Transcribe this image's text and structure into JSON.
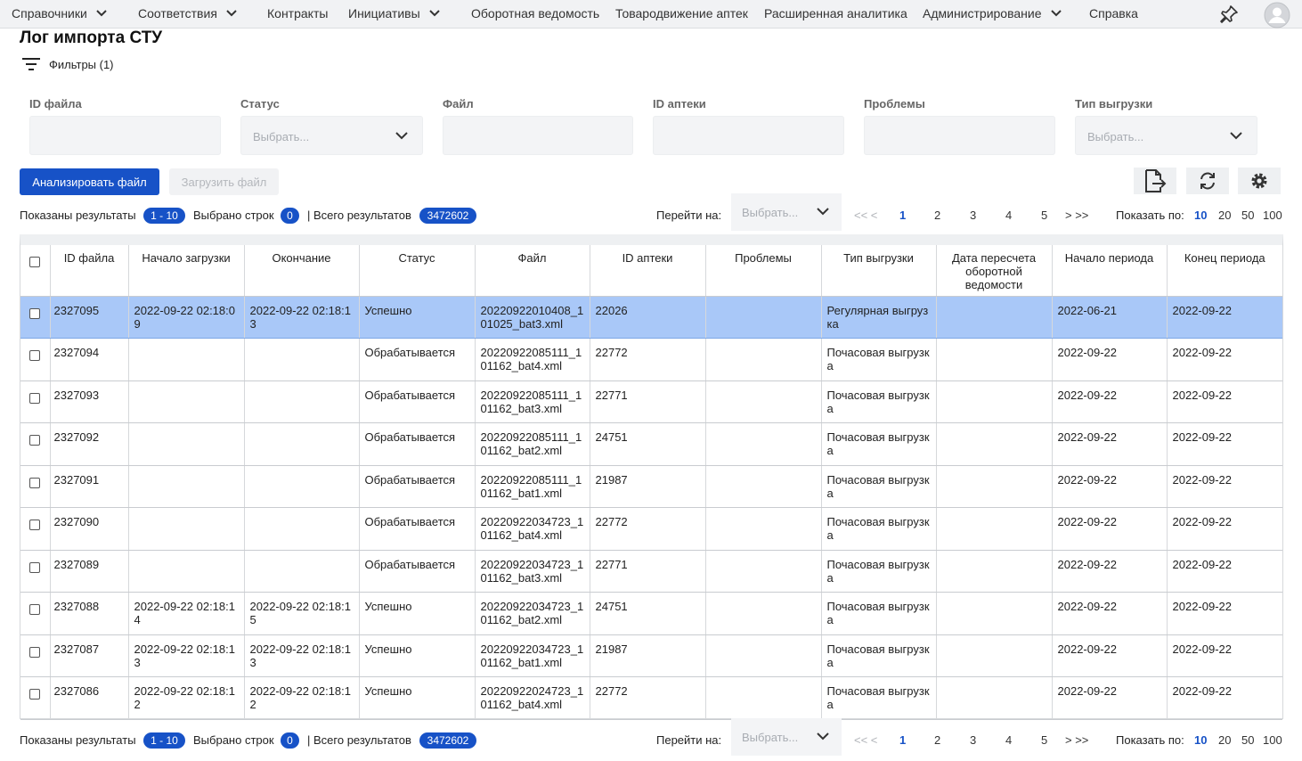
{
  "nav": {
    "items": [
      {
        "label": "Справочники",
        "has_dropdown": true
      },
      {
        "label": "Соответствия",
        "has_dropdown": true
      },
      {
        "label": "Контракты",
        "has_dropdown": false
      },
      {
        "label": "Инициативы",
        "has_dropdown": true
      },
      {
        "label": "Оборотная ведомость",
        "has_dropdown": false
      },
      {
        "label": "Товародвижение аптек",
        "has_dropdown": false
      },
      {
        "label": "Расширенная аналитика",
        "has_dropdown": false
      },
      {
        "label": "Администрирование",
        "has_dropdown": true
      },
      {
        "label": "Справка",
        "has_dropdown": false
      }
    ],
    "icons": [
      "pin-icon",
      "user-avatar-icon"
    ]
  },
  "page": {
    "title": "Лог импорта СТУ",
    "filters_label": "Фильтры (1)"
  },
  "filters": {
    "file_id": {
      "label": "ID файла",
      "value": ""
    },
    "status": {
      "label": "Статус",
      "placeholder": "Выбрать..."
    },
    "file": {
      "label": "Файл",
      "value": ""
    },
    "pharmacy_id": {
      "label": "ID аптеки",
      "value": ""
    },
    "problems": {
      "label": "Проблемы",
      "value": ""
    },
    "export_type": {
      "label": "Тип выгрузки",
      "placeholder": "Выбрать..."
    }
  },
  "toolbar": {
    "analyze_label": "Анализировать файл",
    "upload_label": "Загрузить файл",
    "icons": [
      "export-file-icon",
      "refresh-icon",
      "settings-gear-icon"
    ]
  },
  "pager": {
    "shown_label": "Показаны результаты",
    "shown_range": "1 - 10",
    "selected_label": "Выбрано строк",
    "selected_count": "0",
    "total_label": "| Всего результатов",
    "total_count": "3472602",
    "goto_label": "Перейти на:",
    "goto_placeholder": "Выбрать...",
    "first_prev": "<< <",
    "pages": [
      "1",
      "2",
      "3",
      "4",
      "5"
    ],
    "current_page": "1",
    "next_last": "> >>",
    "page_size_label": "Показать по:",
    "page_sizes": [
      "10",
      "20",
      "50",
      "100"
    ],
    "current_page_size": "10"
  },
  "table": {
    "columns": [
      "ID файла",
      "Начало загрузки",
      "Окончание",
      "Статус",
      "Файл",
      "ID аптеки",
      "Проблемы",
      "Тип выгрузки",
      "Дата пересчета оборотной ведомости",
      "Начало периода",
      "Конец периода"
    ],
    "rows": [
      {
        "id": "2327095",
        "start": "2022-09-22 02:18:09",
        "end": "2022-09-22 02:18:13",
        "status": "Успешно",
        "file": "20220922010408_101025_bat3.xml",
        "pharmacy": "22026",
        "problems": "",
        "type": "Регулярная выгрузка",
        "recalc": "",
        "period_start": "2022-06-21",
        "period_end": "2022-09-22",
        "selected": true
      },
      {
        "id": "2327094",
        "start": "",
        "end": "",
        "status": "Обрабатывается",
        "file": "20220922085111_101162_bat4.xml",
        "pharmacy": "22772",
        "problems": "",
        "type": "Почасовая выгрузка",
        "recalc": "",
        "period_start": "2022-09-22",
        "period_end": "2022-09-22",
        "selected": false
      },
      {
        "id": "2327093",
        "start": "",
        "end": "",
        "status": "Обрабатывается",
        "file": "20220922085111_101162_bat3.xml",
        "pharmacy": "22771",
        "problems": "",
        "type": "Почасовая выгрузка",
        "recalc": "",
        "period_start": "2022-09-22",
        "period_end": "2022-09-22",
        "selected": false
      },
      {
        "id": "2327092",
        "start": "",
        "end": "",
        "status": "Обрабатывается",
        "file": "20220922085111_101162_bat2.xml",
        "pharmacy": "24751",
        "problems": "",
        "type": "Почасовая выгрузка",
        "recalc": "",
        "period_start": "2022-09-22",
        "period_end": "2022-09-22",
        "selected": false
      },
      {
        "id": "2327091",
        "start": "",
        "end": "",
        "status": "Обрабатывается",
        "file": "20220922085111_101162_bat1.xml",
        "pharmacy": "21987",
        "problems": "",
        "type": "Почасовая выгрузка",
        "recalc": "",
        "period_start": "2022-09-22",
        "period_end": "2022-09-22",
        "selected": false
      },
      {
        "id": "2327090",
        "start": "",
        "end": "",
        "status": "Обрабатывается",
        "file": "20220922034723_101162_bat4.xml",
        "pharmacy": "22772",
        "problems": "",
        "type": "Почасовая выгрузка",
        "recalc": "",
        "period_start": "2022-09-22",
        "period_end": "2022-09-22",
        "selected": false
      },
      {
        "id": "2327089",
        "start": "",
        "end": "",
        "status": "Обрабатывается",
        "file": "20220922034723_101162_bat3.xml",
        "pharmacy": "22771",
        "problems": "",
        "type": "Почасовая выгрузка",
        "recalc": "",
        "period_start": "2022-09-22",
        "period_end": "2022-09-22",
        "selected": false
      },
      {
        "id": "2327088",
        "start": "2022-09-22 02:18:14",
        "end": "2022-09-22 02:18:15",
        "status": "Успешно",
        "file": "20220922034723_101162_bat2.xml",
        "pharmacy": "24751",
        "problems": "",
        "type": "Почасовая выгрузка",
        "recalc": "",
        "period_start": "2022-09-22",
        "period_end": "2022-09-22",
        "selected": false
      },
      {
        "id": "2327087",
        "start": "2022-09-22 02:18:13",
        "end": "2022-09-22 02:18:13",
        "status": "Успешно",
        "file": "20220922034723_101162_bat1.xml",
        "pharmacy": "21987",
        "problems": "",
        "type": "Почасовая выгрузка",
        "recalc": "",
        "period_start": "2022-09-22",
        "period_end": "2022-09-22",
        "selected": false
      },
      {
        "id": "2327086",
        "start": "2022-09-22 02:18:12",
        "end": "2022-09-22 02:18:12",
        "status": "Успешно",
        "file": "20220922024723_101162_bat4.xml",
        "pharmacy": "22772",
        "problems": "",
        "type": "Почасовая выгрузка",
        "recalc": "",
        "period_start": "2022-09-22",
        "period_end": "2022-09-22",
        "selected": false
      }
    ]
  },
  "colors": {
    "accent": "#1752c7",
    "selected_row": "#a9c8f8",
    "nav_bg": "#f1f2f4",
    "field_bg": "#f3f4f6"
  }
}
